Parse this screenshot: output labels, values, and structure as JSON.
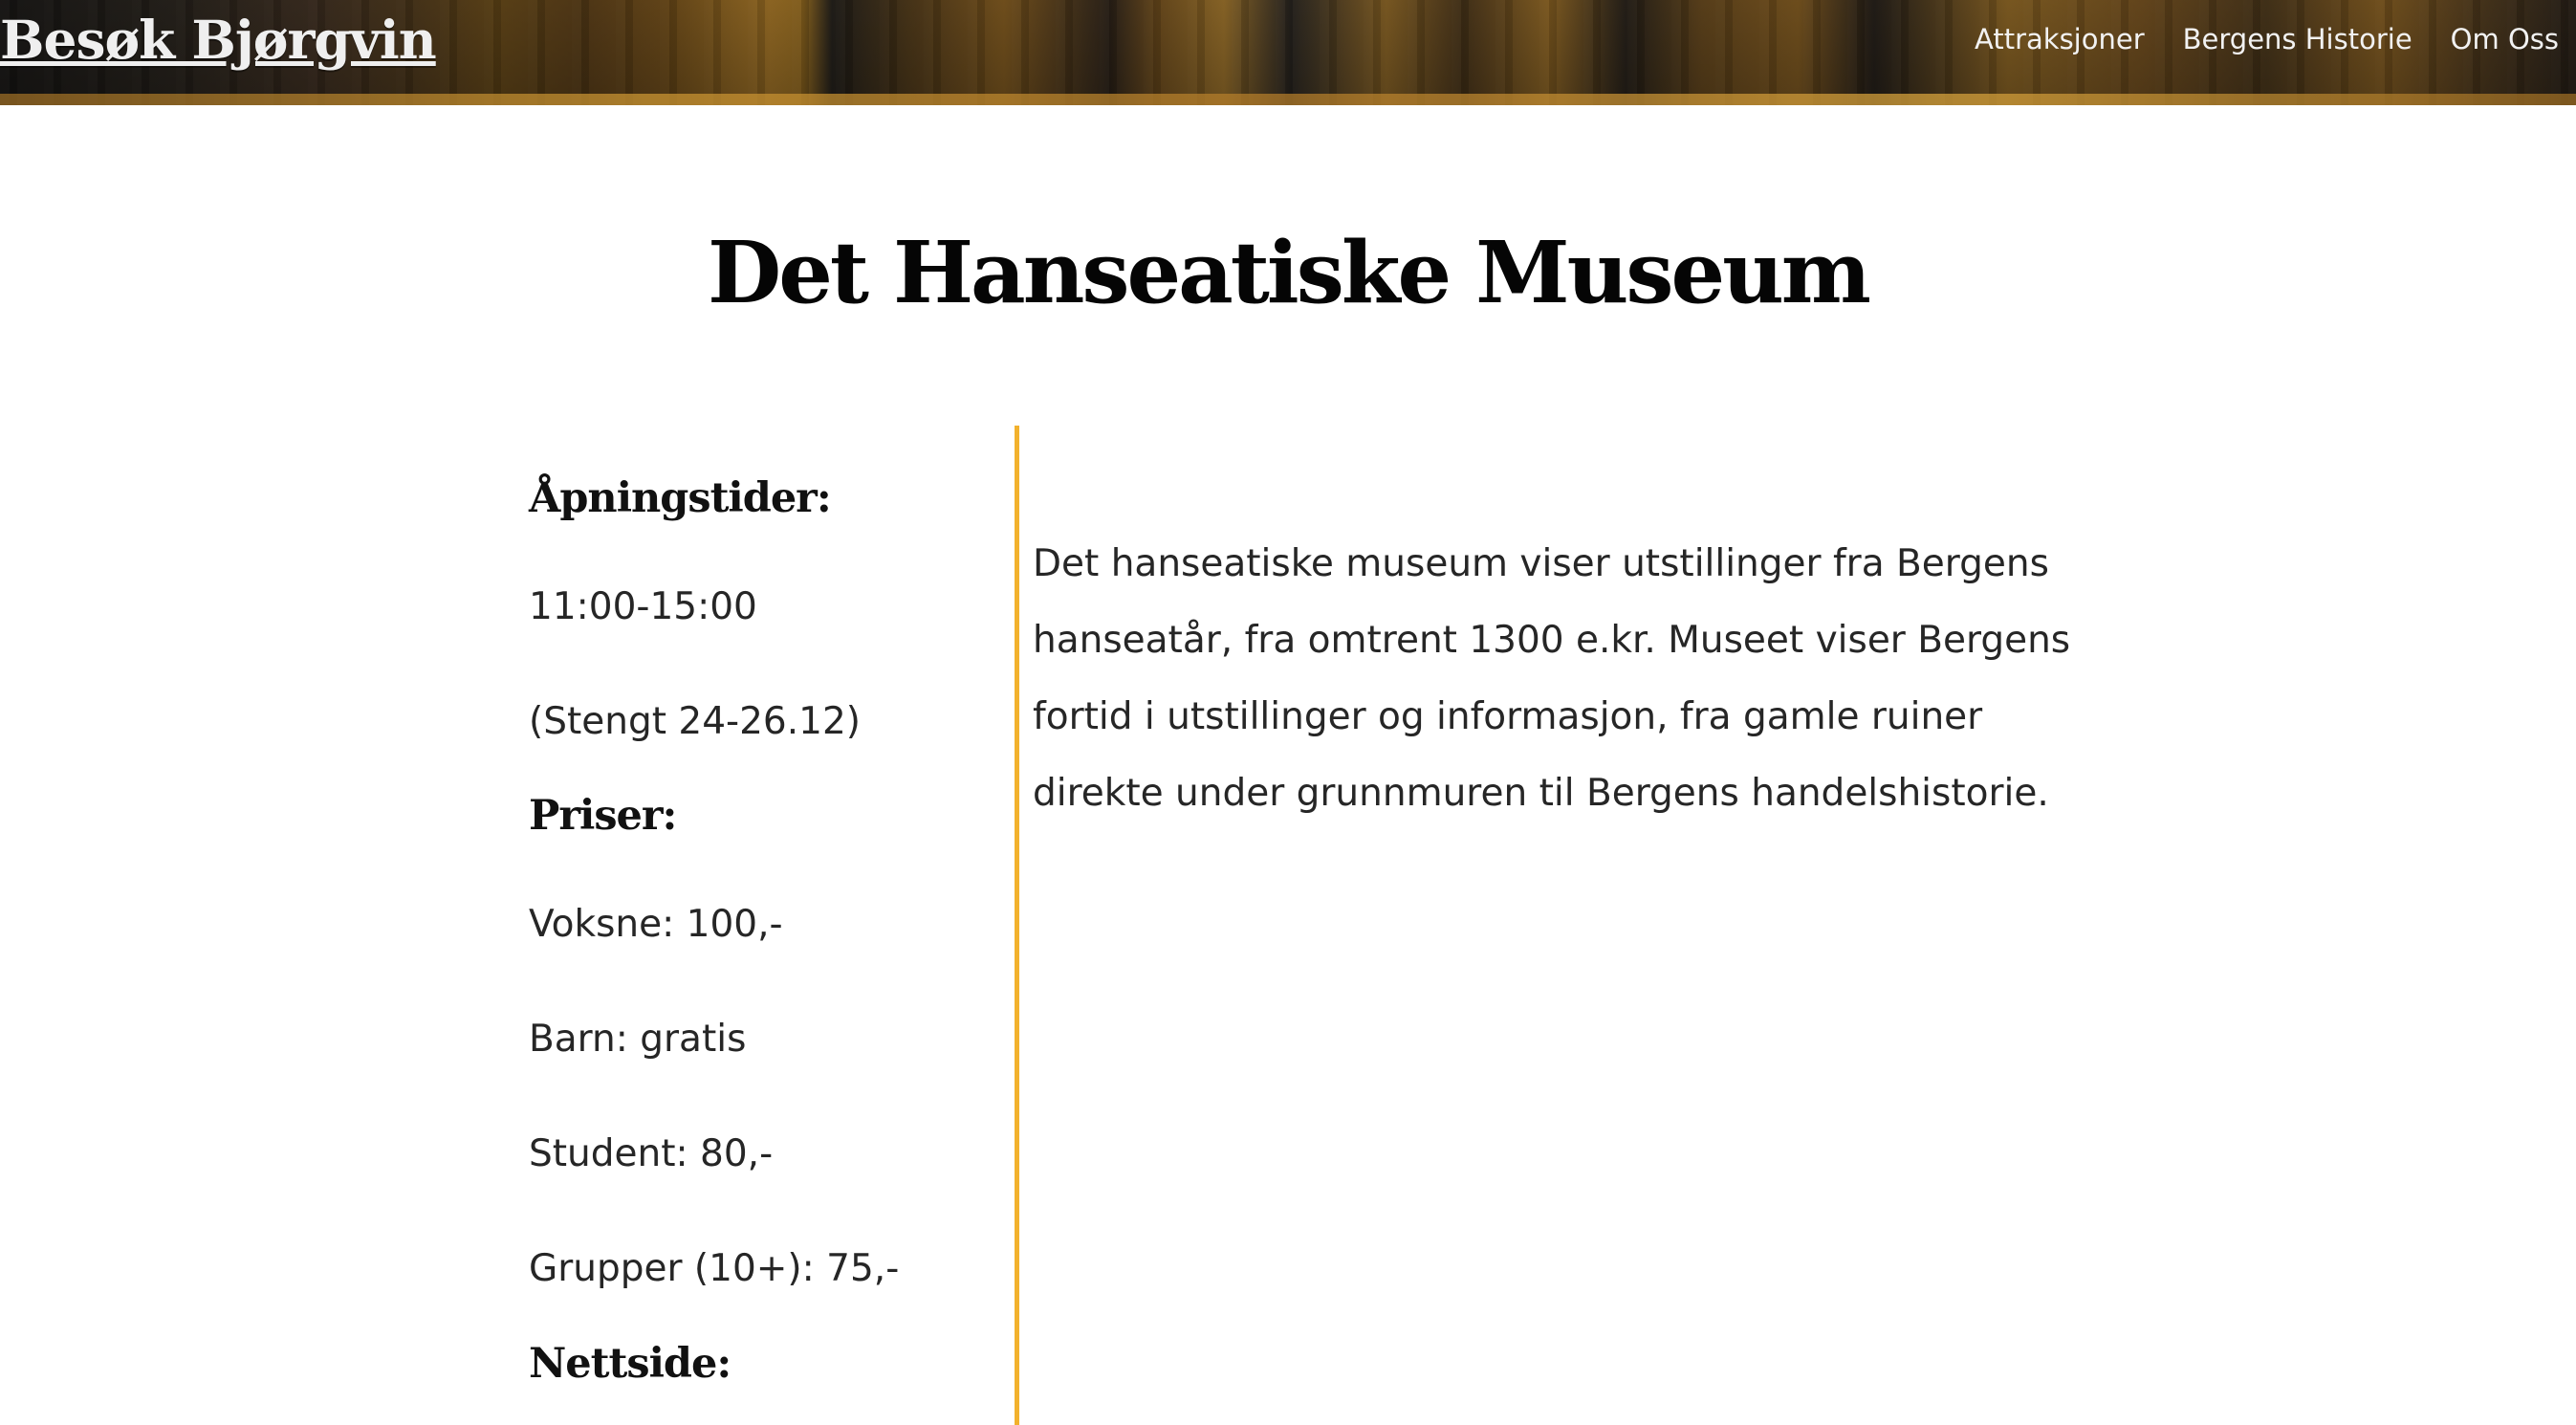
{
  "header": {
    "logo_text": "Besøk Bjørgvin",
    "nav": [
      {
        "label": "Attraksjoner"
      },
      {
        "label": "Bergens Historie"
      },
      {
        "label": "Om Oss"
      }
    ]
  },
  "page": {
    "title": "Det Hanseatiske Museum"
  },
  "info": {
    "opening_heading": "Åpningstider:",
    "opening_hours": "11:00-15:00",
    "closed_note": "(Stengt 24-26.12)",
    "prices_heading": "Priser:",
    "prices": [
      "Voksne: 100,-",
      "Barn: gratis",
      "Student: 80,-",
      "Grupper (10+): 75,-"
    ],
    "website_heading": "Nettside:"
  },
  "description": {
    "text": "Det hanseatiske museum viser utstillinger fra Bergens hanseatår, fra omtrent 1300 e.kr. Museet viser Bergens fortid i utstillinger og informasjon, fra gamle ruiner direkte under grunnmuren til Bergens handelshistorie."
  },
  "colors": {
    "divider": "#f2b12d",
    "header_overlay": "#2b251e",
    "text_primary": "#262626"
  }
}
